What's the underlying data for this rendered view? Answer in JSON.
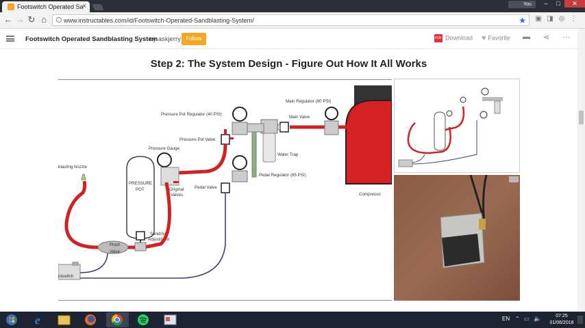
{
  "browser": {
    "tab_title": "Footswitch Operated Sa",
    "tab_close": "×",
    "profile_label": "You",
    "url": "www.instructables.com/id/Footswitch-Operated-Sandblasting-System/"
  },
  "header": {
    "title": "Footswitch Operated Sandblasting System",
    "by_label": "by",
    "author": "askjerry",
    "follow_label": "Follow",
    "download_label": "Download",
    "pdf_badge": "PDF",
    "favorite_label": "Favorite"
  },
  "step": {
    "title": "Step 2: The System Design - Figure Out How It All Works"
  },
  "diagram": {
    "labels": {
      "main_regulator": "Main Regulator (90 PSI)",
      "main_valve": "Main Valve",
      "pressure_pot_regulator": "Pressure Pot Regulator (40 PSI)",
      "pressure_pot_valve": "Pressure Pot Valve",
      "pressure_gauge": "Pressure Gauge",
      "water_trap": "Water Trap",
      "pedal_regulator": "Pedal Regulator (65 PSI)",
      "pedal_valve": "Pedal Valve",
      "blasting_nozzle": "blasting Nozzle",
      "pressure_pot_1": "PRESSURE",
      "pressure_pot_2": "POT",
      "original_valves_1": "Original",
      "original_valves_2": "Valves",
      "sand_air_1": "Sand/Air",
      "sand_air_2": "Adjustment",
      "pinch_valve_1": "Pinch",
      "pinch_valve_2": "Valve",
      "footswitch": "otswitch",
      "compressor": "Compresso"
    }
  },
  "taskbar": {
    "lang": "EN",
    "time": "07:25",
    "date": "01/06/2018"
  },
  "colors": {
    "accent": "#f5a623",
    "hose_red": "#d32020",
    "hose_blue": "#3c3f7a",
    "compressor_red": "#d62222"
  }
}
